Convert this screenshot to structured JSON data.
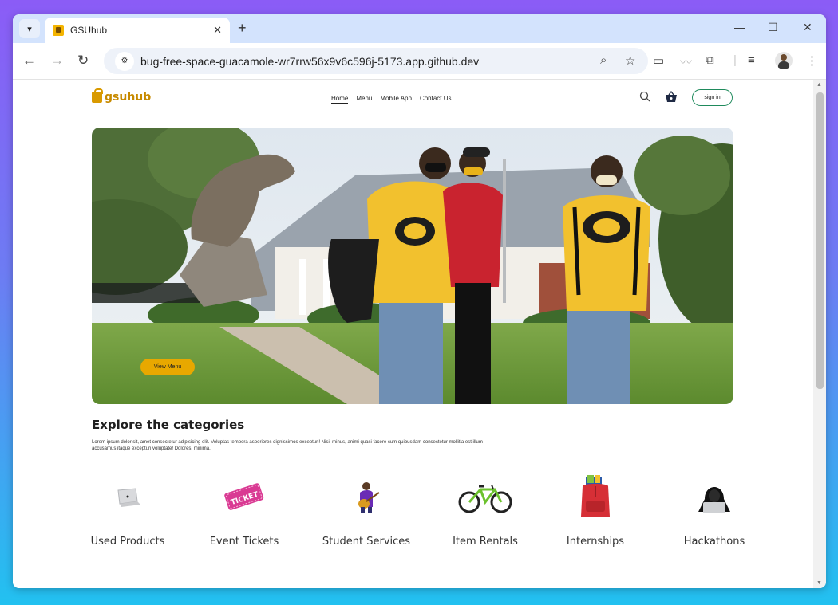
{
  "browser": {
    "tab_title": "GSUhub",
    "url": "bug-free-space-guacamole-wr7rrw56x9v6c596j-5173.app.github.dev"
  },
  "site": {
    "logo_text": "gsuhub",
    "nav": [
      {
        "label": "Home",
        "active": true
      },
      {
        "label": "Menu",
        "active": false
      },
      {
        "label": "Mobile App",
        "active": false
      },
      {
        "label": "Contact Us",
        "active": false
      }
    ],
    "signin_label": "sign in",
    "hero_button_label": "View Menu",
    "section_title": "Explore the categories",
    "section_desc": "Lorem ipsum dolor sit, amet consectetur adipisicing elit. Voluptas tempora asperiores dignissimos excepturi! Nisi, minus, animi quasi facere cum quibusdam consectetur mollitia est illum accusamus itaque excepturi voluptate! Dolores, minima.",
    "categories": [
      {
        "label": "Used Products",
        "icon": "laptop-icon"
      },
      {
        "label": "Event Tickets",
        "icon": "ticket-icon"
      },
      {
        "label": "Student Services",
        "icon": "guitar-student-icon"
      },
      {
        "label": "Item Rentals",
        "icon": "bicycle-icon"
      },
      {
        "label": "Internships",
        "icon": "backpack-icon"
      },
      {
        "label": "Hackathons",
        "icon": "hacker-icon"
      }
    ]
  },
  "colors": {
    "brand": "#c78a00",
    "accent_button": "#e8a800",
    "signin_border": "#1f8a5c"
  }
}
